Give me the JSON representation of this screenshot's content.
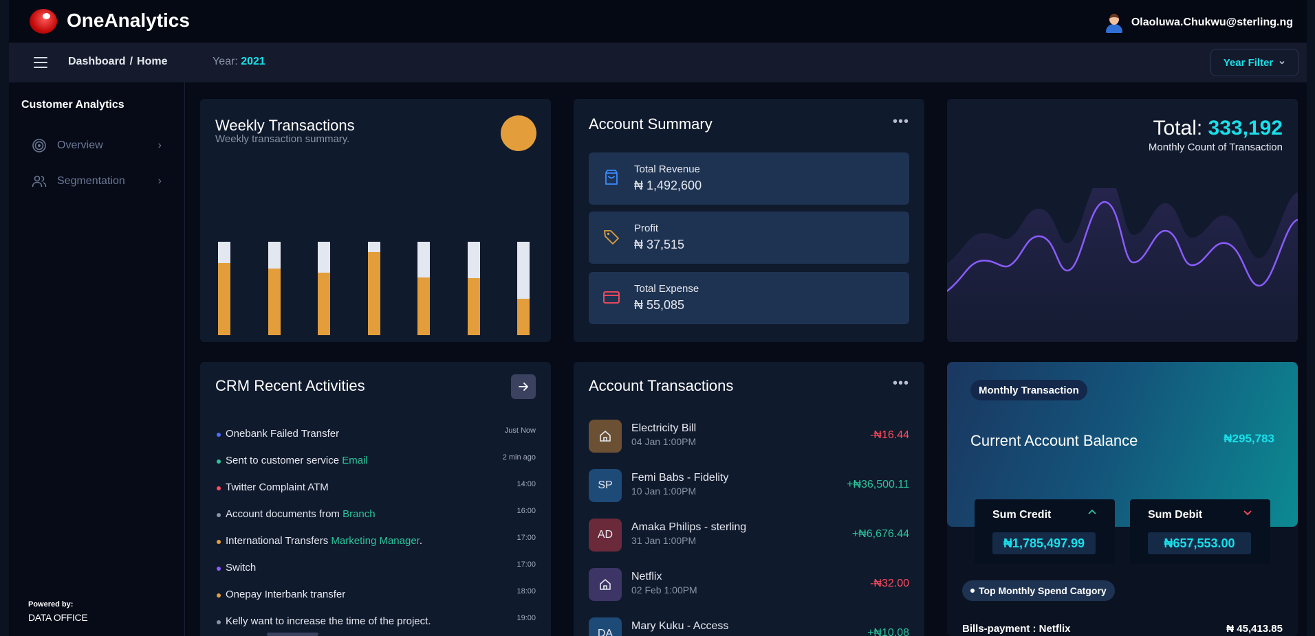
{
  "app": {
    "title": "OneAnalytics",
    "user_email": "Olaoluwa.Chukwu@sterling.ng"
  },
  "subbar": {
    "crumb_1": "Dashboard",
    "crumb_sep": "/",
    "crumb_2": "Home",
    "year_label": "Year:",
    "year_value": "2021",
    "year_filter": "Year Filter"
  },
  "sidebar": {
    "title": "Customer Analytics",
    "items": [
      {
        "label": "Overview",
        "icon": "target-icon"
      },
      {
        "label": "Segmentation",
        "icon": "users-icon"
      }
    ],
    "powered_by": "Powered by:",
    "org": "DATA OFFICE"
  },
  "weekly": {
    "title": "Weekly Transactions",
    "subtitle": "Weekly transaction summary.",
    "accent": "#e39e3b"
  },
  "chart_data": {
    "type": "bar",
    "stacked": true,
    "series": [
      {
        "values": [
          0.77,
          0.71,
          0.67,
          0.89,
          0.62,
          0.61,
          0.39
        ],
        "color": "#e39e3b"
      },
      {
        "values": [
          0.23,
          0.29,
          0.33,
          0.11,
          0.38,
          0.39,
          0.61
        ],
        "color": "#e3e7ef"
      }
    ]
  },
  "summary": {
    "title": "Account Summary",
    "items": [
      {
        "label": "Total Revenue",
        "value": "₦ 1,492,600",
        "icon": "shopping-bag-icon",
        "color": "#3b8bff"
      },
      {
        "label": "Profit",
        "value": "₦ 37,515",
        "icon": "tag-icon",
        "color": "#e39e3b"
      },
      {
        "label": "Total Expense",
        "value": "₦ 55,085",
        "icon": "credit-card-icon",
        "color": "#ff4d5e"
      }
    ]
  },
  "total": {
    "label": "Total:",
    "value": "333,192",
    "subtitle": "Monthly Count of Transaction"
  },
  "crm": {
    "title": "CRM Recent Activities",
    "items": [
      {
        "text": "Onebank Failed Transfer",
        "link": "",
        "suffix": "",
        "time": "Just Now",
        "color": "#4a6cff"
      },
      {
        "text": "Sent to customer service ",
        "link": "Email",
        "suffix": "",
        "time": "2 min ago",
        "color": "#2bc49b"
      },
      {
        "text": "Twitter Complaint ATM",
        "link": "",
        "suffix": "",
        "time": "14:00",
        "color": "#ff4d5e"
      },
      {
        "text": "Account documents from ",
        "link": "Branch",
        "suffix": "",
        "time": "16:00",
        "color": "#8a93a8"
      },
      {
        "text": "International Transfers ",
        "link": "Marketing Manager",
        "suffix": ".",
        "time": "17:00",
        "color": "#e39e3b"
      },
      {
        "text": "Switch",
        "link": "",
        "suffix": "",
        "time": "17:00",
        "color": "#8a5cff"
      },
      {
        "text": "Onepay Interbank transfer",
        "link": "",
        "suffix": "",
        "time": "18:00",
        "color": "#e39e3b"
      },
      {
        "text": "Kelly want to increase the time of the project.",
        "link": "",
        "suffix": "",
        "time": "19:00",
        "color": "#8a93a8"
      }
    ]
  },
  "transactions": {
    "title": "Account Transactions",
    "items": [
      {
        "name": "Electricity Bill",
        "date": "04 Jan 1:00PM",
        "amount": "-₦16.44",
        "avatar": "",
        "icon": "home-icon",
        "bg": "#6b5033",
        "sign": "neg"
      },
      {
        "name": "Femi Babs - Fidelity",
        "date": "10 Jan 1:00PM",
        "amount": "+₦36,500.11",
        "avatar": "SP",
        "icon": "",
        "bg": "#1e4a78",
        "sign": "pos"
      },
      {
        "name": "Amaka Philips - sterling",
        "date": "31 Jan 1:00PM",
        "amount": "+₦6,676.44",
        "avatar": "AD",
        "icon": "",
        "bg": "#6a2a3a",
        "sign": "pos"
      },
      {
        "name": "Netflix",
        "date": "02 Feb 1:00PM",
        "amount": "-₦32.00",
        "avatar": "",
        "icon": "home-icon",
        "bg": "#3c3566",
        "sign": "neg"
      },
      {
        "name": "Mary Kuku - Access",
        "date": "",
        "amount": "+₦10.08",
        "avatar": "DA",
        "icon": "",
        "bg": "#1e4a78",
        "sign": "pos"
      }
    ]
  },
  "balance": {
    "pill": "Monthly Transaction",
    "label": "Current Account Balance",
    "value": "₦295,783",
    "credit_label": "Sum Credit",
    "credit_value": "₦1,785,497.99",
    "debit_label": "Sum Debit",
    "debit_value": "₦657,553.00",
    "category_pill": "Top Monthly Spend Catgory",
    "category_name": "Bills-payment : Netflix",
    "category_value": "₦ 45,413.85"
  }
}
